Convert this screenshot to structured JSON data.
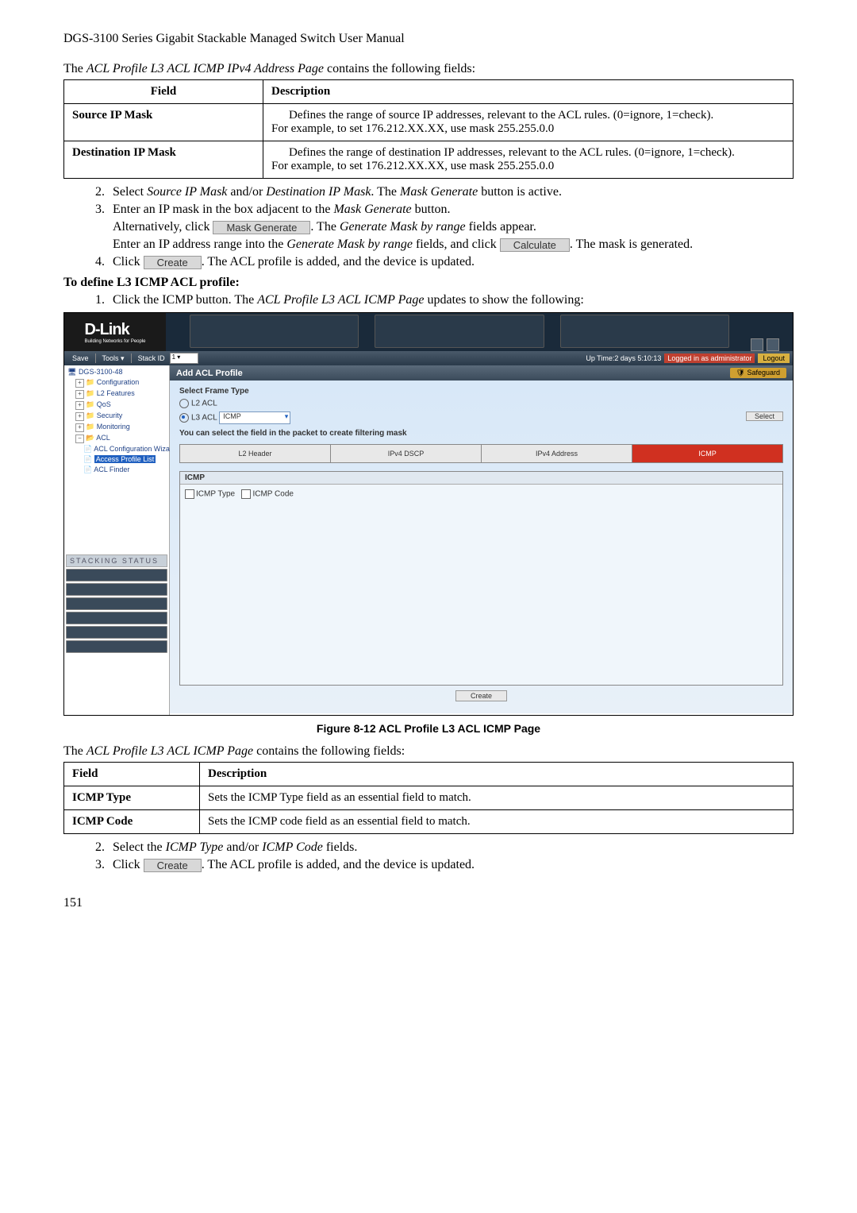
{
  "header": "DGS-3100 Series Gigabit Stackable Managed Switch User Manual",
  "intro1_pre": "The ",
  "intro1_em": "ACL Profile L3 ACL ICMP IPv4 Address Page",
  "intro1_post": " contains the following fields:",
  "table1": {
    "h1": "Field",
    "h2": "Description",
    "r1f": "Source IP Mask",
    "r1d1": "Defines the range of source IP addresses, relevant to the ACL rules. (0=ignore, 1=check).",
    "r1d2": "For example, to set 176.212.XX.XX, use mask 255.255.0.0",
    "r2f": "Destination IP Mask",
    "r2d1": "Defines the range of destination IP addresses, relevant to the ACL rules. (0=ignore, 1=check).",
    "r2d2": "For example, to set 176.212.XX.XX, use mask 255.255.0.0"
  },
  "steps_a": {
    "s2n": "2.",
    "s2": "Select Source IP Mask and/or Destination IP Mask. The Mask Generate button is active.",
    "s3n": "3.",
    "s3": "Enter an IP mask in the box adjacent to the Mask Generate button.",
    "s3b_pre": "Alternatively, click ",
    "s3b_btn": "Mask Generate",
    "s3b_post": ". The Generate Mask by range fields appear.",
    "s3c_pre": "Enter an IP address range into the Generate Mask by range fields, and click ",
    "s3c_btn": "Calculate",
    "s3c_post": ". The mask is generated.",
    "s4n": "4.",
    "s4_pre": "Click ",
    "s4_btn": "Create",
    "s4_post": ". The ACL profile is added, and the device is updated."
  },
  "heading_b": "To define L3 ICMP ACL profile:",
  "steps_b": {
    "s1n": "1.",
    "s1": "Click the ICMP button. The ACL Profile L3 ACL ICMP Page updates to show the following:"
  },
  "ss": {
    "logo": "D-Link",
    "logo_sub": "Building Networks for People",
    "tb_save": "Save",
    "tb_tools": "Tools",
    "tb_stack": "Stack ID",
    "tb_stack_val": "1",
    "tb_uptime": "Up Time:2 days 5:10:13",
    "tb_logged": "Logged in as administrator",
    "tb_logout": "Logout",
    "tree_root": "DGS-3100-48",
    "tree_cfg": "Configuration",
    "tree_l2": "L2 Features",
    "tree_qos": "QoS",
    "tree_sec": "Security",
    "tree_mon": "Monitoring",
    "tree_acl": "ACL",
    "tree_acl_wiz": "ACL Configuration Wizard",
    "tree_acl_prof": "Access Profile List",
    "tree_acl_find": "ACL Finder",
    "stack_hdr": "STACKING STATUS",
    "panel_title": "Add ACL Profile",
    "safeguard": "Safeguard",
    "frame_label": "Select Frame Type",
    "l2acl": "L2 ACL",
    "l3acl": "L3 ACL",
    "dd_val": "ICMP",
    "sel_btn": "Select",
    "hint": "You can select the field in the packet to create filtering mask",
    "tab1": "L2 Header",
    "tab2": "IPv4 DSCP",
    "tab3": "IPv4 Address",
    "tab4": "ICMP",
    "icmp_hdr": "ICMP",
    "icmp_type": "ICMP Type",
    "icmp_code": "ICMP Code",
    "create": "Create"
  },
  "caption": "Figure 8-12 ACL Profile L3 ACL ICMP Page",
  "intro2_pre": "The ",
  "intro2_em": "ACL Profile L3 ACL ICMP Page",
  "intro2_post": " contains the following fields:",
  "table2": {
    "h1": "Field",
    "h2": "Description",
    "r1f": "ICMP Type",
    "r1d": "Sets the ICMP Type field as an essential field to match.",
    "r2f": "ICMP Code",
    "r2d": "Sets the ICMP code field as an essential field to match."
  },
  "steps_c": {
    "s2n": "2.",
    "s2": "Select the ICMP Type and/or ICMP Code fields.",
    "s3n": "3.",
    "s3_pre": "Click ",
    "s3_btn": "Create",
    "s3_post": ". The ACL profile is added, and the device is updated."
  },
  "pagenum": "151"
}
